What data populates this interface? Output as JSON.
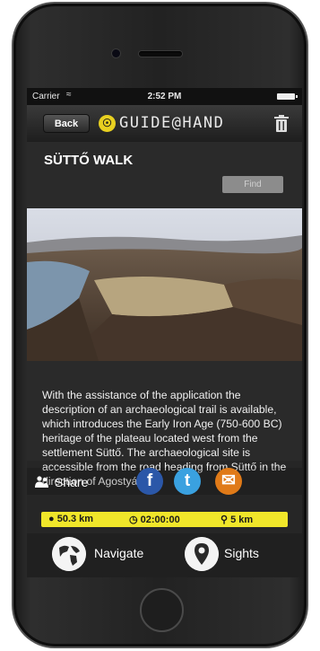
{
  "status": {
    "carrier": "Carrier",
    "time": "2:52 PM"
  },
  "navbar": {
    "back_label": "Back",
    "brand": "GUIDE@HAND"
  },
  "walk": {
    "title": "SÜTTŐ WALK",
    "find_label": "Find",
    "description": "With the assistance of the application the description of an archaeological trail is available, which introduces the Early Iron Age (750-600 BC) heritage of the plateau located west from the settlement Süttő. The archaeological site is accessible from the road heading from Süttő in the direction of Agostyán"
  },
  "share": {
    "label": "Share"
  },
  "stats": {
    "distance": "50.3 km",
    "duration": "02:00:00",
    "walk": "5 km"
  },
  "bottom_nav": {
    "navigate_label": "Navigate",
    "sights_label": "Sights"
  },
  "icons": {
    "share": "people-icon",
    "facebook": "facebook-icon",
    "twitter": "twitter-icon",
    "mail": "mail-icon",
    "navigate": "globe-icon",
    "sights": "map-pin-icon",
    "trash": "trash-icon"
  },
  "colors": {
    "stats_bar": "#f0e62a",
    "facebook": "#2b57a8",
    "twitter": "#3aa1e0",
    "mail": "#e07a18"
  }
}
